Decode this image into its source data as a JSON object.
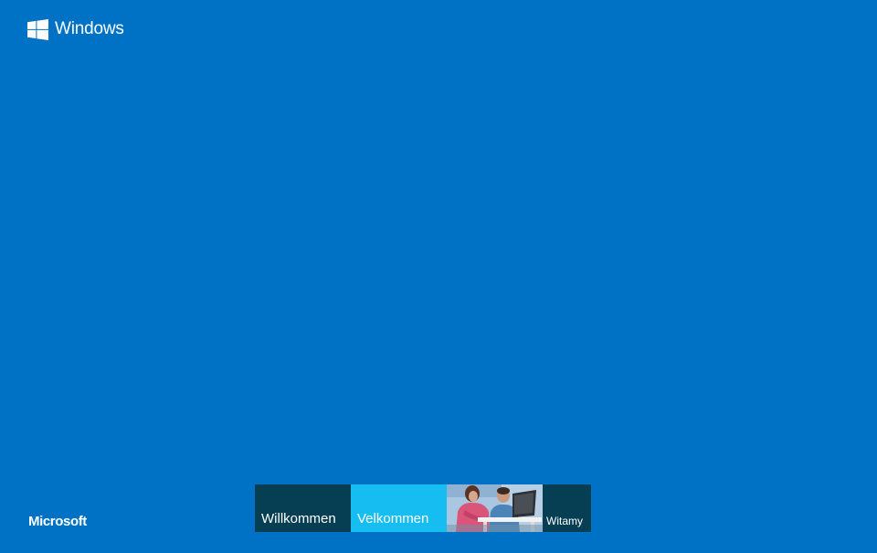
{
  "header": {
    "brand_name": "Windows",
    "logo_icon": "windows-logo-icon"
  },
  "footer": {
    "company": "Microsoft"
  },
  "tiles": [
    {
      "label": "Willkommen",
      "color": "#063f54"
    },
    {
      "label": "Velkommen",
      "color": "#15bdf0"
    },
    {
      "label": "",
      "image": "people-with-laptop-photo",
      "color": "#b8d4ea"
    },
    {
      "label": "Witamy",
      "color": "#063f54"
    }
  ],
  "colors": {
    "background": "#0072c6",
    "text": "#ffffff"
  }
}
